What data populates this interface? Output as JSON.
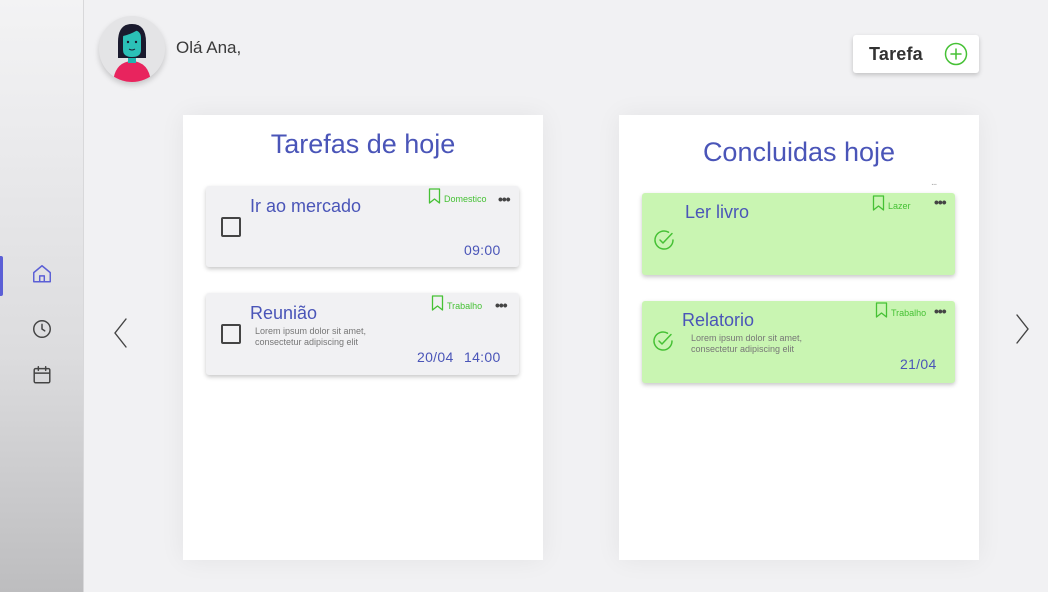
{
  "header": {
    "greeting": "Olá Ana,",
    "add_task_label": "Tarefa"
  },
  "sidebar": {
    "items": [
      {
        "icon": "home-icon",
        "active": true
      },
      {
        "icon": "clock-icon",
        "active": false
      },
      {
        "icon": "calendar-icon",
        "active": false
      }
    ]
  },
  "today": {
    "title": "Tarefas de hoje",
    "tasks": [
      {
        "title": "Ir ao mercado",
        "tag": "Domestico",
        "time": "09:00",
        "description": ""
      },
      {
        "title": "Reunião",
        "tag": "Trabalho",
        "date": "20/04",
        "time": "14:00",
        "description": "Lorem ipsum dolor sit amet, consectetur adipiscing elit"
      }
    ]
  },
  "done": {
    "title": "Concluidas hoje",
    "more": "...",
    "tasks": [
      {
        "title": "Ler livro",
        "tag": "Lazer",
        "date": ""
      },
      {
        "title": "Relatorio",
        "tag": "Trabalho",
        "date": "21/04",
        "description": "Lorem ipsum dolor sit amet, consectetur adipiscing elit"
      }
    ]
  },
  "colors": {
    "accent": "#4a55b8",
    "tag_green": "#46c135",
    "done_card": "#c9f5b2",
    "nav_active": "#5b5fd6"
  },
  "menu_dots": "•••"
}
